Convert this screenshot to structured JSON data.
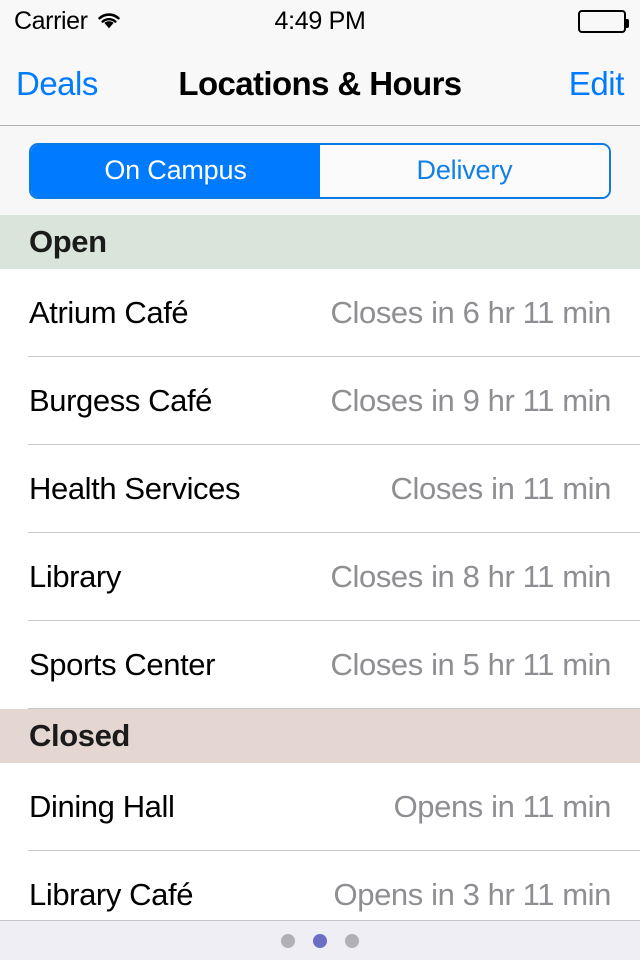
{
  "status_bar": {
    "carrier": "Carrier",
    "wifi_icon": "wifi-icon",
    "time": "4:49 PM",
    "battery_icon": "battery-full-icon"
  },
  "nav_bar": {
    "back_label": "Deals",
    "title": "Locations & Hours",
    "edit_label": "Edit"
  },
  "segmented_control": {
    "selected_index": 0,
    "segments": [
      {
        "label": "On Campus",
        "selected": true
      },
      {
        "label": "Delivery",
        "selected": false
      }
    ]
  },
  "list": {
    "sections": [
      {
        "header": "Open",
        "header_color": "#d9e5da",
        "rows": [
          {
            "title": "Atrium Café",
            "detail": "Closes in 6 hr 11 min"
          },
          {
            "title": "Burgess Café",
            "detail": "Closes in 9 hr 11 min"
          },
          {
            "title": "Health Services",
            "detail": "Closes in 11 min"
          },
          {
            "title": "Library",
            "detail": "Closes in 8 hr 11 min"
          },
          {
            "title": "Sports Center",
            "detail": "Closes in 5 hr 11 min"
          }
        ]
      },
      {
        "header": "Closed",
        "header_color": "#e4d7d2",
        "rows": [
          {
            "title": "Dining Hall",
            "detail": "Opens in 11 min"
          },
          {
            "title": "Library Café",
            "detail": "Opens in 3 hr 11 min"
          }
        ]
      }
    ]
  },
  "page_control": {
    "total": 3,
    "current": 2,
    "active_color": "#6b6fc2",
    "inactive_color": "#b0b0b5"
  },
  "colors": {
    "tint": "#007aff",
    "detail_text": "#8e8e93",
    "separator": "#c8c7cc",
    "bar_background": "#f8f8f8"
  }
}
